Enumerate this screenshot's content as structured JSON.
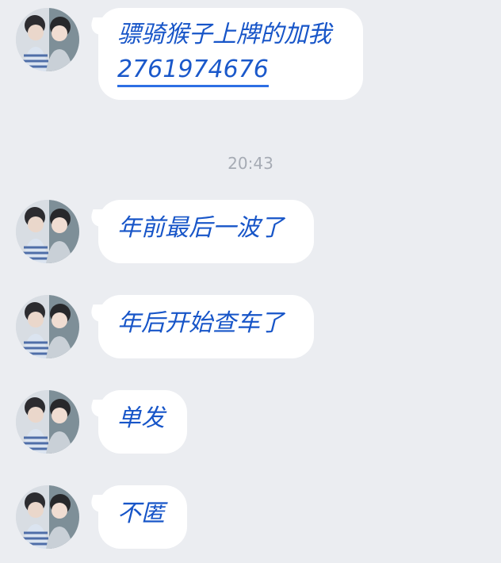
{
  "theme": {
    "background": "#ebedf1",
    "bubble_background": "#ffffff",
    "message_color": "#1755c8",
    "timestamp_color": "#a6abb4"
  },
  "chat": {
    "top_message": {
      "line1": "骠骑猴子上牌的加我",
      "link": "2761974676"
    },
    "timestamp": "20:43",
    "messages": [
      {
        "text": "年前最后一波了"
      },
      {
        "text": "年后开始查车了"
      },
      {
        "text": "单发"
      },
      {
        "text": "不匿"
      }
    ],
    "avatar_icon": "profile-photo-avatar"
  }
}
